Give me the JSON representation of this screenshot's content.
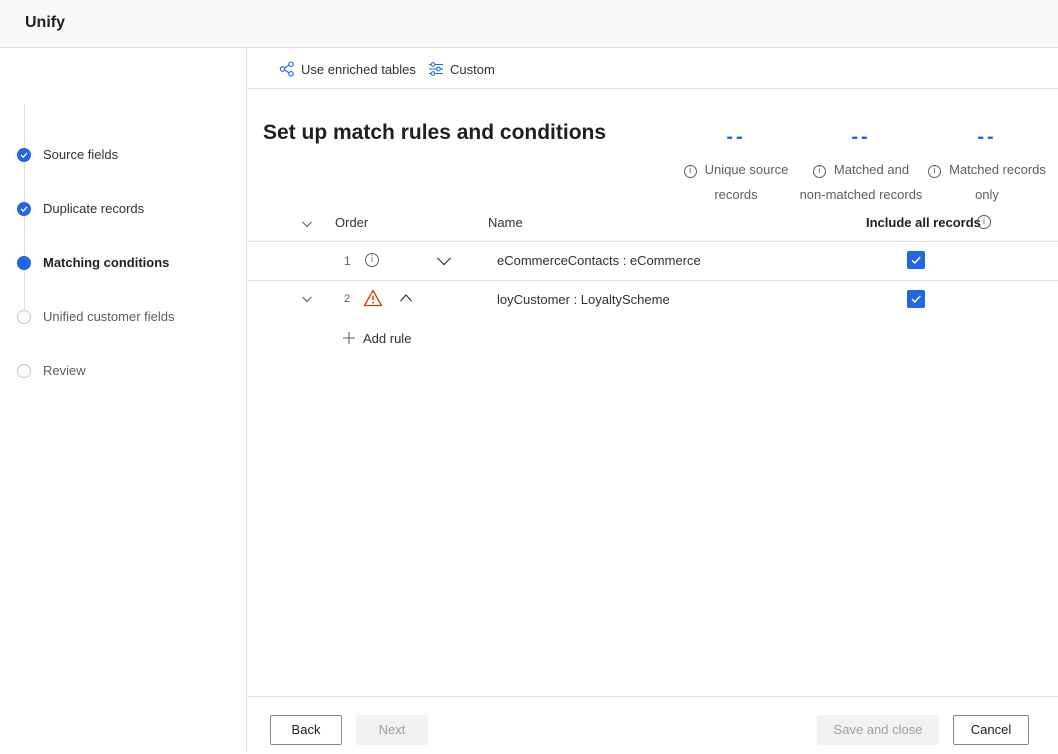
{
  "app": {
    "title": "Unify"
  },
  "steps": [
    {
      "label": "Source fields",
      "state": "done"
    },
    {
      "label": "Duplicate records",
      "state": "done"
    },
    {
      "label": "Matching conditions",
      "state": "current"
    },
    {
      "label": "Unified customer fields",
      "state": "pending"
    },
    {
      "label": "Review",
      "state": "pending"
    }
  ],
  "commands": {
    "enriched": {
      "label": "Use enriched tables",
      "icon": "share-nodes-icon"
    },
    "custom": {
      "label": "Custom",
      "icon": "sliders-icon"
    }
  },
  "page": {
    "heading": "Set up match rules and conditions"
  },
  "metrics": [
    {
      "value": "--",
      "line1": "Unique source",
      "line2": "records"
    },
    {
      "value": "--",
      "line1": "Matched and",
      "line2": "non-matched records"
    },
    {
      "value": "--",
      "line1": "Matched records",
      "line2": "only"
    }
  ],
  "table": {
    "columns": {
      "order": "Order",
      "name": "Name",
      "include": "Include all records"
    },
    "rows": [
      {
        "order": "1",
        "status_icon": "info-icon",
        "name": "eCommerceContacts : eCommerce",
        "include": true,
        "expanded": false
      },
      {
        "order": "2",
        "status_icon": "warning-icon",
        "name": "loyCustomer : LoyaltyScheme",
        "include": true,
        "expanded": true
      }
    ],
    "add_rule": "Add rule"
  },
  "footer": {
    "back": "Back",
    "next": "Next",
    "save_close": "Save and close",
    "cancel": "Cancel"
  },
  "colors": {
    "accent": "#2266e3",
    "warning": "#d83b01"
  }
}
